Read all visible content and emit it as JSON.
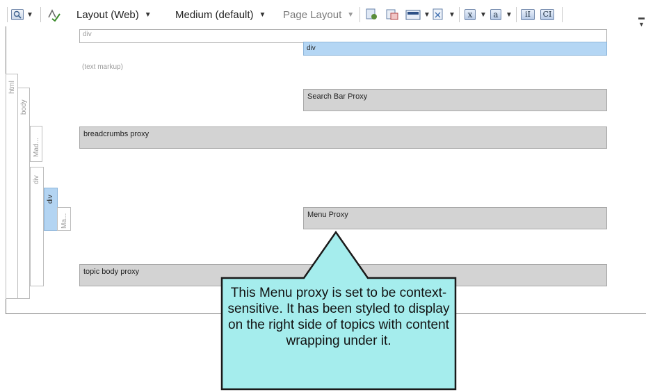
{
  "toolbar": {
    "layout_label": "Layout (Web)",
    "medium_label": "Medium (default)",
    "page_layout_label": "Page Layout",
    "xref_icon_text": "x",
    "a_icon_text": "a",
    "il_icon_text": "iI",
    "cl_icon_text": "CI"
  },
  "structure_bars": {
    "html": "html",
    "body": "body",
    "mad": "Mad...",
    "div": "div",
    "div_selected": "div",
    "ma": "Ma..."
  },
  "content": {
    "div_outer": "div",
    "div_inner": "div",
    "text_markup": "(text markup)",
    "search_bar_proxy": "Search Bar Proxy",
    "breadcrumbs_proxy": "breadcrumbs proxy",
    "menu_proxy": "Menu Proxy",
    "topic_body_proxy": "topic body proxy"
  },
  "callout": {
    "text": "This Menu proxy is set to be context-sensitive. It has been styled to display on the right side of topics with content wrapping under it.",
    "fill_color": "#A5EDED",
    "border_color": "#1a1a1a"
  }
}
